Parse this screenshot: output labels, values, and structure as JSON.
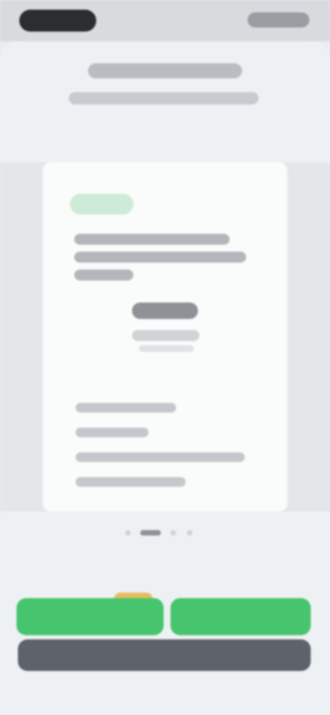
{
  "header": {
    "title": "",
    "subtitle": ""
  },
  "card": {
    "badge": "",
    "value": "",
    "caption": ""
  },
  "pager": {
    "pages": 4,
    "active_index": 1
  },
  "actions": {
    "primary_left": "",
    "primary_right": "",
    "secondary": ""
  },
  "colors": {
    "accent_green": "#47c56e",
    "badge_green": "#cdebd6",
    "tag_yellow": "#e6bd62",
    "dark_button": "#5e636b"
  }
}
